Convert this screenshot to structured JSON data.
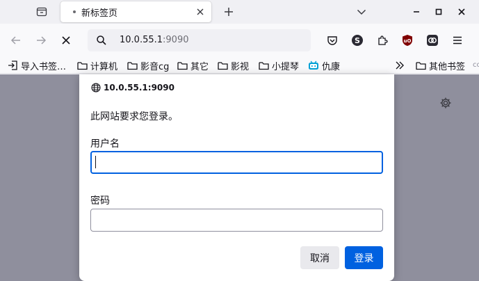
{
  "tab": {
    "title": "新标签页"
  },
  "urlbar": {
    "host": "10.0.55.1",
    "port": ":9090"
  },
  "bookmarks": {
    "items": [
      {
        "label": "导入书签…",
        "icon": "import-icon"
      },
      {
        "label": "计算机",
        "icon": "folder-icon"
      },
      {
        "label": "影音cg",
        "icon": "folder-icon"
      },
      {
        "label": "其它",
        "icon": "folder-icon"
      },
      {
        "label": "影视",
        "icon": "folder-icon"
      },
      {
        "label": "小提琴",
        "icon": "folder-icon"
      },
      {
        "label": "仇康",
        "icon": "bilibili-icon"
      }
    ],
    "other_label": "其他书签",
    "edge_text": "cc"
  },
  "dialog": {
    "origin": "10.0.55.1:9090",
    "message": "此网站要求您登录。",
    "username_label": "用户名",
    "username_value": "",
    "password_label": "密码",
    "password_value": "",
    "cancel_label": "取消",
    "login_label": "登录"
  },
  "colors": {
    "accent": "#0061e0",
    "backdrop": "#8f8f9d"
  }
}
